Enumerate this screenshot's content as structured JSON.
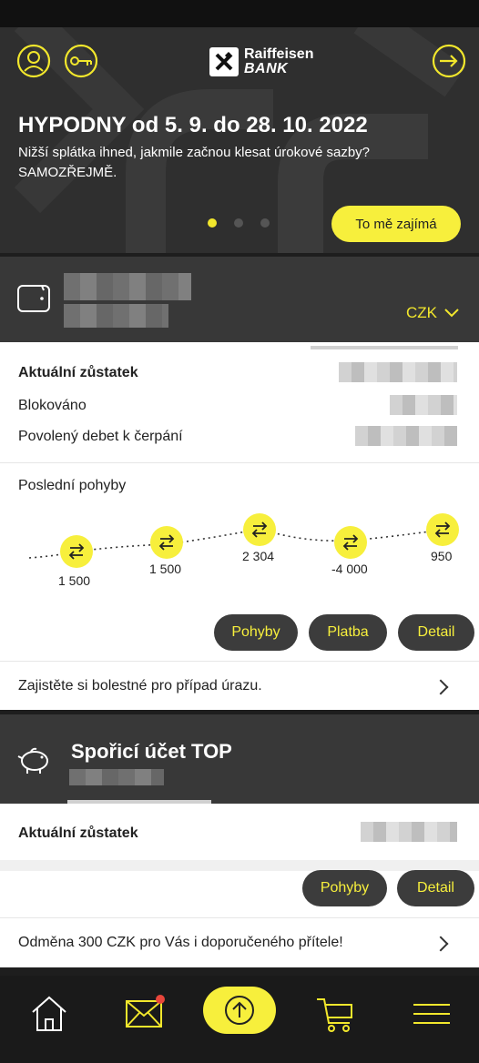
{
  "hero": {
    "title": "HYPODNY od 5. 9. do 28. 10. 2022",
    "subtitle": "Nižší splátka ihned, jakmile začnou klesat úrokové sazby? SAMOZŘEJMĚ.",
    "cta": "To mě zajímá",
    "brand_line1": "Raiffeisen",
    "brand_line2": "BANK",
    "dots_total": 3,
    "dots_active": 1
  },
  "account1": {
    "currency": "CZK",
    "balance_label": "Aktuální zůstatek",
    "blocked_label": "Blokováno",
    "overdraft_label": "Povolený debet k čerpání",
    "movements_title": "Poslední pohyby",
    "movements": [
      "1 500",
      "1 500",
      "2 304",
      "-4 000",
      "950"
    ],
    "buttons": {
      "movements": "Pohyby",
      "payment": "Platba",
      "detail": "Detail"
    },
    "promo": "Zajistěte si bolestné pro případ úrazu."
  },
  "account2": {
    "name": "Spořicí účet TOP",
    "balance_label": "Aktuální zůstatek",
    "buttons": {
      "movements": "Pohyby",
      "detail": "Detail"
    },
    "promo": "Odměna 300 CZK pro Vás i doporučeného přítele!"
  },
  "nav": {
    "items": [
      "home-icon",
      "mail-icon",
      "upload-icon",
      "cart-icon",
      "menu-icon"
    ],
    "mail_has_notification": true
  },
  "colors": {
    "accent": "#f7ef3c",
    "dark": "#383838",
    "hero_bg": "#2f2f2f"
  }
}
